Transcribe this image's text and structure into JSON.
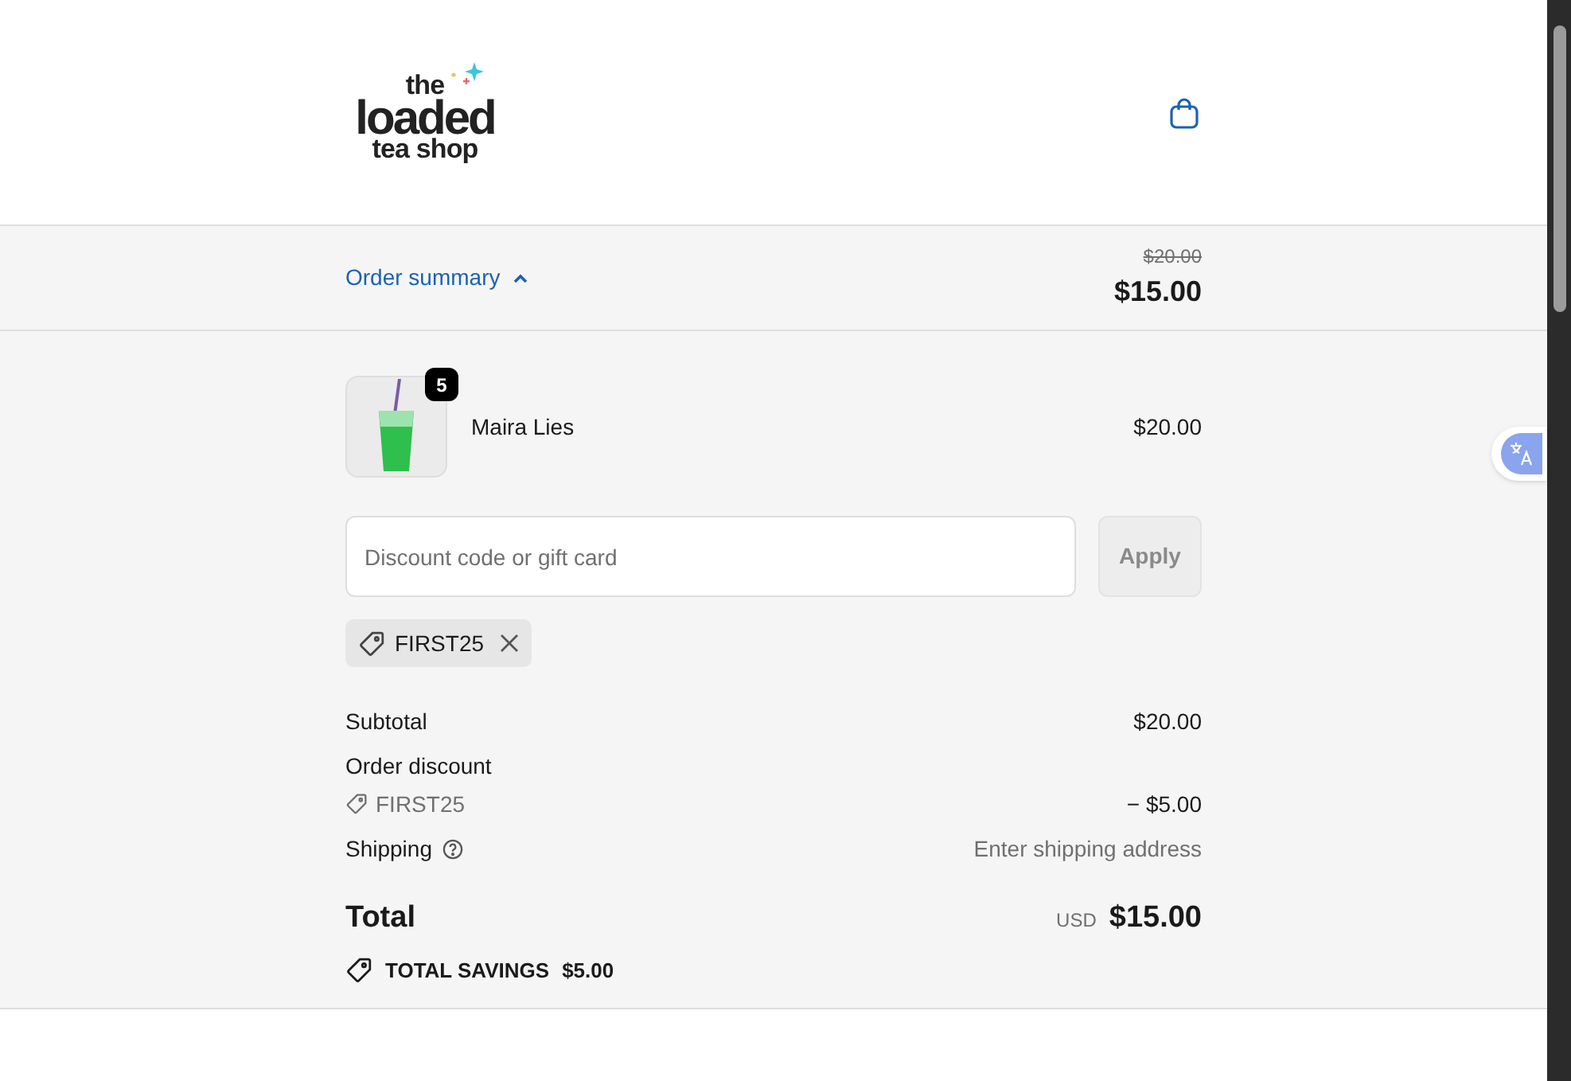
{
  "logo": {
    "lines": [
      "the",
      "loaded",
      "tea shop"
    ]
  },
  "summary_bar": {
    "toggle_label": "Order summary",
    "expanded": true,
    "compare_price": "$20.00",
    "total": "$15.00"
  },
  "line_items": [
    {
      "name": "Maira Lies",
      "quantity": "5",
      "price": "$20.00"
    }
  ],
  "discount_field": {
    "placeholder": "Discount code or gift card"
  },
  "apply_button": {
    "label": "Apply",
    "disabled": true
  },
  "applied_codes": [
    {
      "code": "FIRST25"
    }
  ],
  "summary_rows": [
    {
      "kind": "subtotal",
      "label": "Subtotal",
      "value": "$20.00"
    },
    {
      "kind": "heading",
      "label": "Order discount"
    },
    {
      "kind": "code",
      "label": "FIRST25",
      "value": "− $5.00"
    },
    {
      "kind": "shipping",
      "label": "Shipping",
      "value": "Enter shipping address"
    }
  ],
  "total": {
    "label": "Total",
    "currency": "USD",
    "value": "$15.00"
  },
  "savings": {
    "label": "TOTAL SAVINGS",
    "value": "$5.00"
  }
}
